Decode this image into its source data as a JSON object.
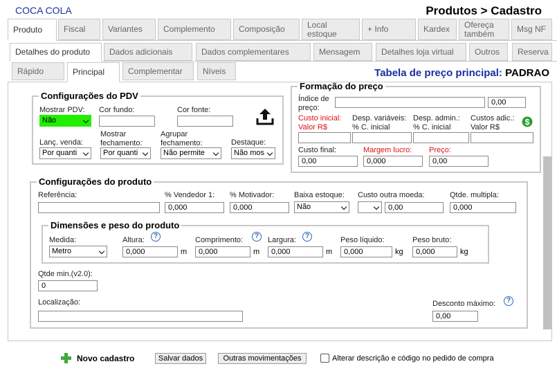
{
  "header": {
    "company": "COCA COLA",
    "title": "Produtos > Cadastro"
  },
  "tabs_row1": [
    "Produto",
    "Fiscal",
    "Variantes",
    "Complemento",
    "Composição",
    "Local estoque",
    "+ Info",
    "Kardex",
    "Ofereça também",
    "Msg NF"
  ],
  "tabs_row2": [
    "Detalhes do produto",
    "Dados adicionais",
    "Dados complementares",
    "Mensagem",
    "Detalhes loja virtual",
    "Outros",
    "Reserva"
  ],
  "tabs_row3": [
    "Rápido",
    "Principal",
    "Complementar",
    "Níveis"
  ],
  "price_table": {
    "label": "Tabela de preço principal:",
    "value": "PADRAO"
  },
  "pdv": {
    "legend": "Configurações do PDV",
    "mostrar_pdv": {
      "label": "Mostrar PDV:",
      "value": "Não"
    },
    "cor_fundo": {
      "label": "Cor fundo:",
      "value": ""
    },
    "cor_fonte": {
      "label": "Cor fonte:",
      "value": ""
    },
    "lanc_venda": {
      "label": "Lanç. venda:",
      "value": "Por quanti"
    },
    "mostrar_fechamento": {
      "label": "Mostrar fechamento:",
      "value": "Por quanti"
    },
    "agrupar_fechamento": {
      "label": "Agrupar fechamento:",
      "value": "Não permite"
    },
    "destaque": {
      "label": "Destaque:",
      "value": "Não mos"
    }
  },
  "preco": {
    "legend": "Formação do preço",
    "indice": {
      "label": "Índice de preço:",
      "value": "",
      "value2": "0,00"
    },
    "custo_inicial": {
      "label": "Custo inicial: Valor R$",
      "value": ""
    },
    "desp_variaveis": {
      "label": "Desp. variáveis: % C. inicial",
      "value": ""
    },
    "desp_admin": {
      "label": "Desp. admin.: % C. inicial",
      "value": ""
    },
    "custos_adic": {
      "label": "Custos adic.: Valor R$",
      "value": ""
    },
    "custo_final": {
      "label": "Custo final:",
      "value": "0,00"
    },
    "margem_lucro": {
      "label": "Margem lucro:",
      "value": "0,000"
    },
    "preco": {
      "label": "Preço:",
      "value": "0,00"
    }
  },
  "produto": {
    "legend": "Configurações do produto",
    "referencia": {
      "label": "Referência:",
      "value": ""
    },
    "vendedor": {
      "label": "% Vendedor 1:",
      "value": "0,000"
    },
    "motivador": {
      "label": "% Motivador:",
      "value": "0,000"
    },
    "baixa_estoque": {
      "label": "Baixa estoque:",
      "value": "Não"
    },
    "custo_outra_moeda": {
      "label": "Custo outra moeda:",
      "currency": "",
      "value": "0,00"
    },
    "qtde_multipla": {
      "label": "Qtde. multipla:",
      "value": "0,000"
    },
    "qtde_min": {
      "label": "Qtde min.(v2.0):",
      "value": "0"
    },
    "localizacao": {
      "label": "Localização:",
      "value": ""
    },
    "desconto_maximo": {
      "label": "Desconto máximo:",
      "value": "0,00"
    }
  },
  "dimensoes": {
    "legend": "Dimensões e peso do produto",
    "medida": {
      "label": "Medida:",
      "value": "Metro"
    },
    "altura": {
      "label": "Altura:",
      "value": "0,000",
      "unit": "m"
    },
    "comprimento": {
      "label": "Comprimento:",
      "value": "0,000",
      "unit": "m"
    },
    "largura": {
      "label": "Largura:",
      "value": "0,000",
      "unit": "m"
    },
    "peso_liquido": {
      "label": "Peso líquido:",
      "value": "0,000",
      "unit": "kg"
    },
    "peso_bruto": {
      "label": "Peso bruto:",
      "value": "0,000",
      "unit": "kg"
    }
  },
  "footer": {
    "novo": "Novo cadastro",
    "salvar": "Salvar dados",
    "outras": "Outras movimentações",
    "alterar": "Alterar descrição e código no pedido de compra"
  },
  "colors": {
    "brand": "#1a2fa0",
    "highlight": "#22ee00",
    "required": "#dd1111",
    "money_icon": "#2e9d2e"
  }
}
